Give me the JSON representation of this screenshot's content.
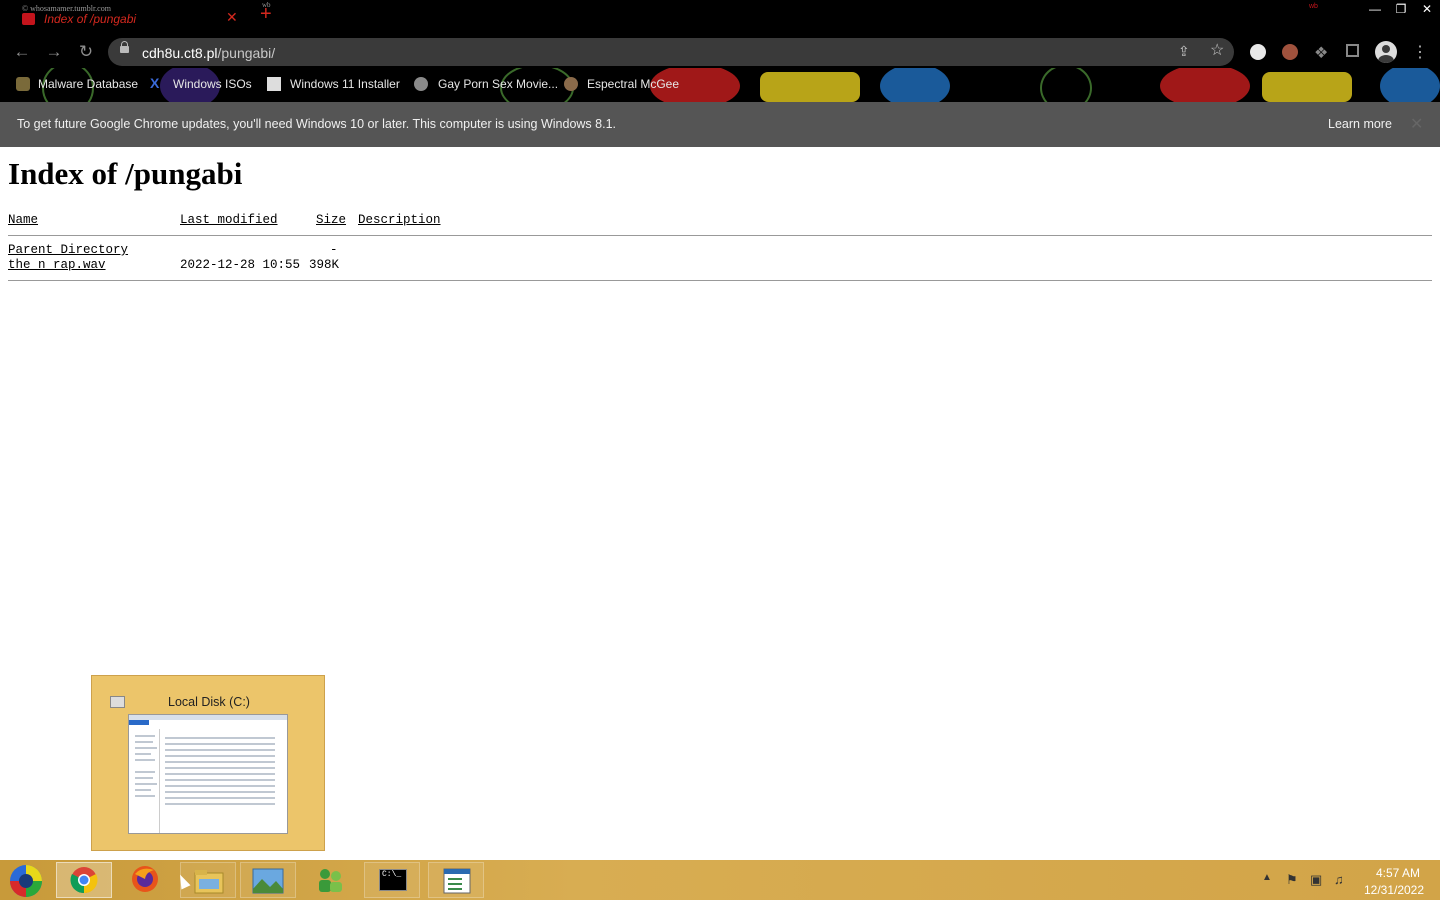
{
  "browser": {
    "tab": {
      "tooltip": "© whosamamer.tumblr.com",
      "title": "Index of /pungabi",
      "close": "✕"
    },
    "new_tab": "+",
    "new_tab_tooltip": "wb",
    "profile_tooltip": "wb",
    "window_controls": {
      "minimize": "—",
      "restore": "❐",
      "close": "✕"
    },
    "url": {
      "host": "cdh8u.ct8.pl",
      "path": "/pungabi/"
    },
    "nav": {
      "back": "←",
      "forward": "→",
      "reload": "↻"
    },
    "bookmarks": [
      {
        "label": "Malware Database",
        "icon": "figure-icon"
      },
      {
        "label": "Windows ISOs",
        "icon": "x-logo-icon"
      },
      {
        "label": "Windows 11 Installer",
        "icon": "document-icon"
      },
      {
        "label": "Gay Porn Sex Movie...",
        "icon": "figure-icon"
      },
      {
        "label": "Espectral McGee",
        "icon": "figure-icon"
      }
    ],
    "colors": {
      "frame": "#000000",
      "omnibox": "#3a3a3a",
      "tab_text": "#d4281e"
    }
  },
  "infobar": {
    "message": "To get future Google Chrome updates, you'll need Windows 10 or later. This computer is using Windows 8.1.",
    "action": "Learn more",
    "close": "✕"
  },
  "page": {
    "heading": "Index of /pungabi",
    "columns": {
      "name": "Name",
      "last_modified": "Last modified",
      "size": "Size",
      "description": "Description"
    },
    "rows": [
      {
        "name": "Parent Directory",
        "modified": "",
        "size": "-"
      },
      {
        "name": "the_n_rap.wav",
        "modified": "2022-12-28 10:55",
        "size": "398K"
      }
    ]
  },
  "thumbnail": {
    "title": "Local Disk (C:)"
  },
  "taskbar": {
    "apps": [
      {
        "name": "start-button",
        "icon": "start-icon"
      },
      {
        "name": "chrome",
        "icon": "chrome-icon",
        "active": true
      },
      {
        "name": "firefox",
        "icon": "firefox-icon"
      },
      {
        "name": "file-explorer",
        "icon": "folder-icon"
      },
      {
        "name": "photos",
        "icon": "landscape-icon"
      },
      {
        "name": "control-panel",
        "icon": "users-icon"
      },
      {
        "name": "command-prompt",
        "icon": "terminal-icon",
        "label": "C:\\_"
      },
      {
        "name": "notepad",
        "icon": "notepad-icon"
      }
    ],
    "tray": {
      "up_arrow": "▲",
      "flag": "⚑",
      "network": "▣",
      "volume": "♫"
    },
    "time": "4:57 AM",
    "date": "12/31/2022"
  }
}
